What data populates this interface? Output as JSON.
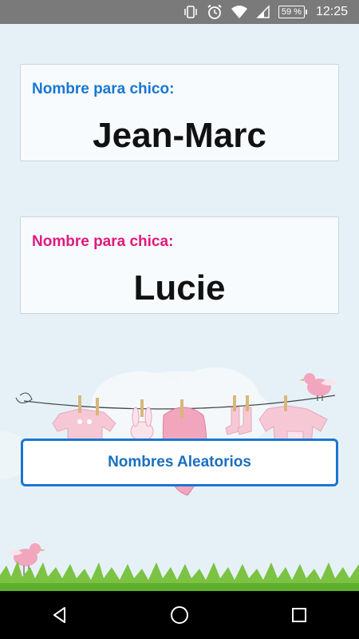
{
  "status_bar": {
    "battery_percent": "59 %",
    "time": "12:25",
    "icons": [
      "vibrate-icon",
      "alarm-icon",
      "wifi-icon",
      "signal-icon",
      "battery-icon"
    ]
  },
  "boy_card": {
    "label": "Nombre para chico:",
    "name": "Jean-Marc",
    "label_color": "#1976d2"
  },
  "girl_card": {
    "label": "Nombre para chica:",
    "name": "Lucie",
    "label_color": "#e0197d"
  },
  "random_button": {
    "label": "Nombres Aleatorios",
    "accent": "#1976d2"
  },
  "nav_bar": {
    "buttons": [
      "back-icon",
      "home-icon",
      "recents-icon"
    ]
  }
}
